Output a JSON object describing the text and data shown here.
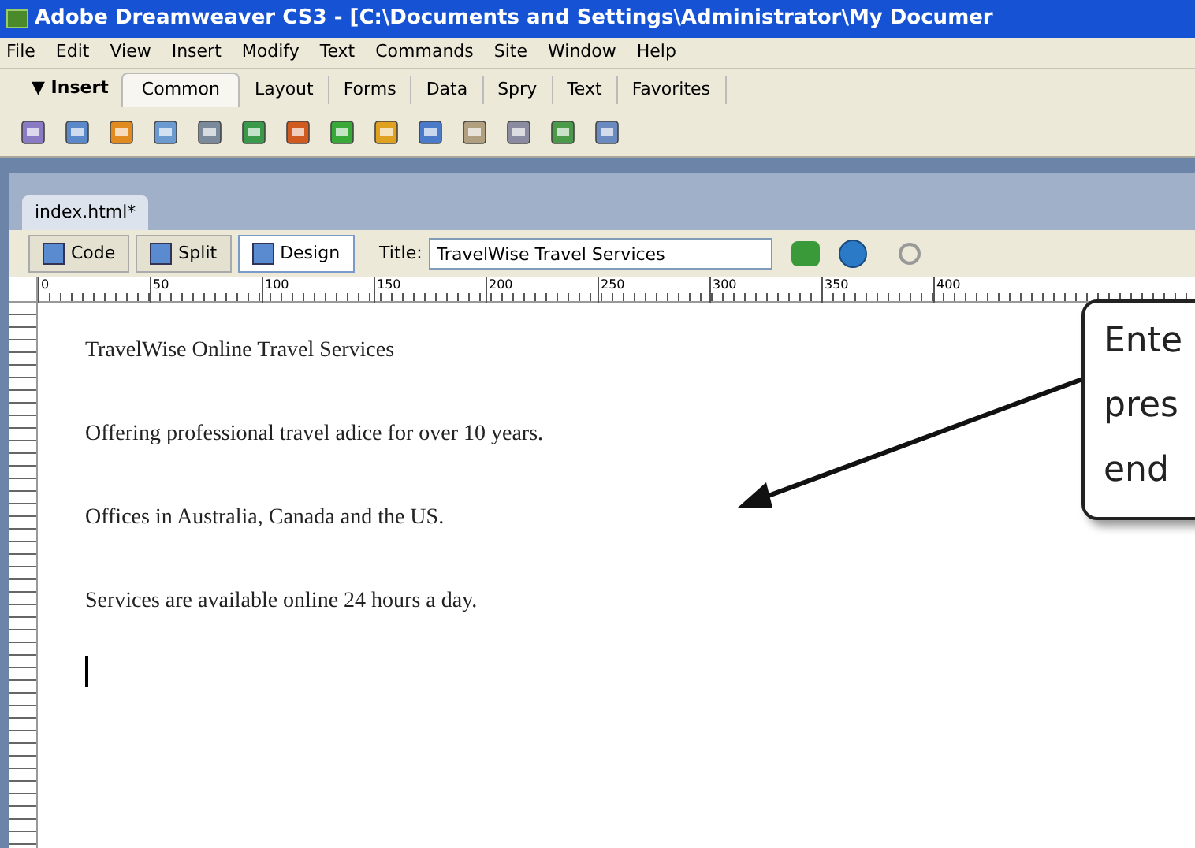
{
  "window": {
    "title": "Adobe Dreamweaver CS3 - [C:\\Documents and Settings\\Administrator\\My Documer"
  },
  "menu": [
    "File",
    "Edit",
    "View",
    "Insert",
    "Modify",
    "Text",
    "Commands",
    "Site",
    "Window",
    "Help"
  ],
  "insert_bar": {
    "label": "▼ Insert",
    "tabs": [
      {
        "label": "Common",
        "selected": true
      },
      {
        "label": "Layout",
        "selected": false
      },
      {
        "label": "Forms",
        "selected": false
      },
      {
        "label": "Data",
        "selected": false
      },
      {
        "label": "Spry",
        "selected": false
      },
      {
        "label": "Text",
        "selected": false
      },
      {
        "label": "Favorites",
        "selected": false
      }
    ]
  },
  "document_tab": {
    "label": "index.html*"
  },
  "view_buttons": [
    {
      "label": "Code",
      "selected": false
    },
    {
      "label": "Split",
      "selected": false
    },
    {
      "label": "Design",
      "selected": true
    }
  ],
  "title_field": {
    "label": "Title:",
    "value": "TravelWise Travel Services"
  },
  "ruler_marks": [
    "0",
    "50",
    "100",
    "150",
    "200",
    "250",
    "300",
    "350",
    "400"
  ],
  "paragraphs": [
    "TravelWise Online Travel Services",
    "Offering professional travel adice for over 10 years.",
    "Offices in Australia, Canada and the US.",
    "Services are available online 24 hours a day."
  ],
  "callout": {
    "lines": [
      "Ente",
      "pres",
      "end"
    ]
  }
}
